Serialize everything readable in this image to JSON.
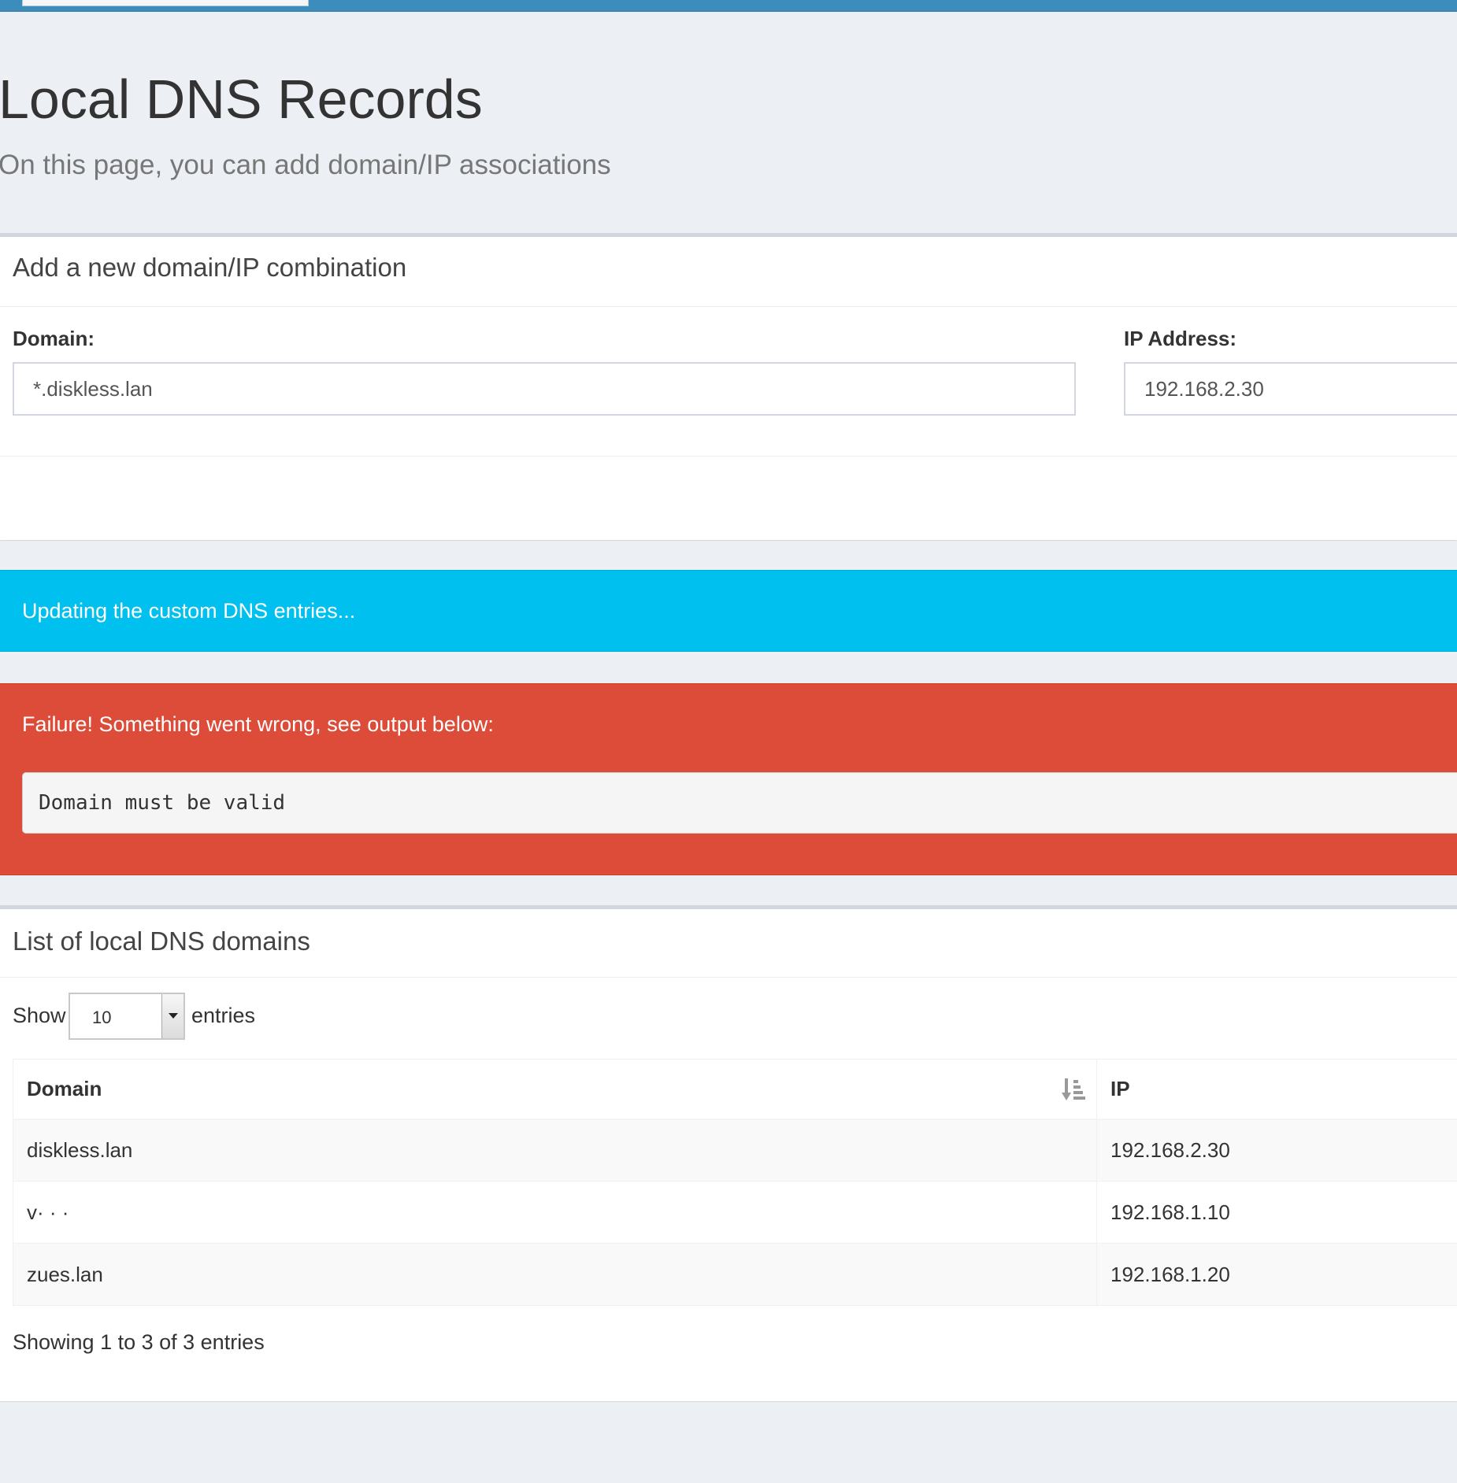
{
  "header": {
    "title": "Local DNS Records",
    "subtitle": "On this page, you can add domain/IP associations"
  },
  "add_box": {
    "title": "Add a new domain/IP combination",
    "domain_label": "Domain:",
    "domain_value": "*.diskless.lan",
    "ip_label": "IP Address:",
    "ip_value": "192.168.2.30"
  },
  "alerts": {
    "info": "Updating the custom DNS entries...",
    "failure": "Failure! Something went wrong, see output below:",
    "output": "Domain must be valid"
  },
  "list_box": {
    "title": "List of local DNS domains",
    "show_label": "Show",
    "entries_value": "10",
    "entries_label": "entries",
    "columns": {
      "domain": "Domain",
      "ip": "IP"
    },
    "rows": [
      {
        "domain": "diskless.lan",
        "ip": "192.168.2.30"
      },
      {
        "domain": "v· · ·",
        "ip": "192.168.1.10"
      },
      {
        "domain": "zues.lan",
        "ip": "192.168.1.20"
      }
    ],
    "info": "Showing 1 to 3 of 3 entries"
  },
  "colors": {
    "topbar": "#3c8dbc",
    "background": "#ecf0f5",
    "info": "#00c0ef",
    "danger": "#dd4b39"
  },
  "icons": {
    "sort": "sort-amount-down-icon",
    "dropdown": "caret-down-icon"
  }
}
